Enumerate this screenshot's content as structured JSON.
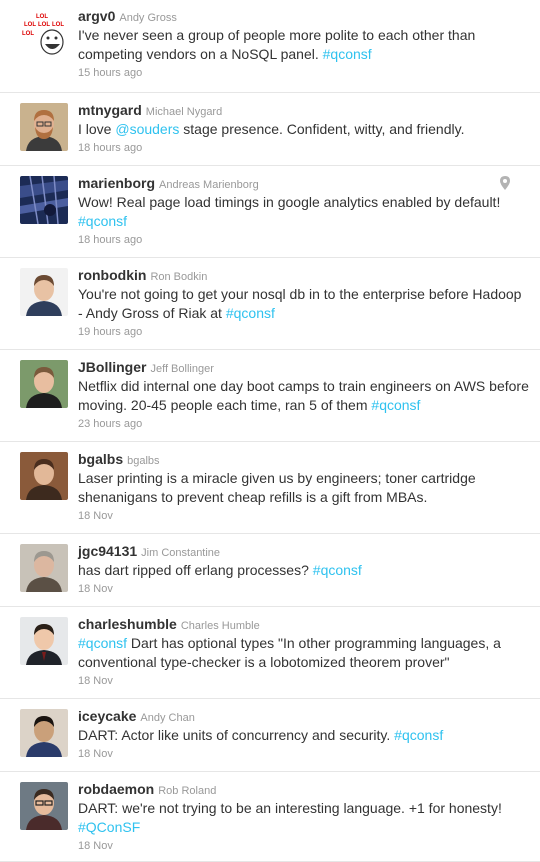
{
  "tweets": [
    {
      "screen_name": "argv0",
      "full_name": "Andy Gross",
      "avatar": "lol-face",
      "text": [
        {
          "t": "I've never seen a group of people more polite to each other than competing vendors on a NoSQL panel. "
        },
        {
          "t": "#qconsf",
          "link": true
        }
      ],
      "time": "15 hours ago"
    },
    {
      "screen_name": "mtnygard",
      "full_name": "Michael Nygard",
      "avatar": "bearded-man",
      "text": [
        {
          "t": "I love "
        },
        {
          "t": "@souders",
          "link": true
        },
        {
          "t": " stage presence. Confident, witty, and friendly."
        }
      ],
      "time": "18 hours ago"
    },
    {
      "screen_name": "marienborg",
      "full_name": "Andreas Marienborg",
      "avatar": "blue-abstract",
      "geo": "location-pin-icon",
      "text": [
        {
          "t": "Wow! Real page load timings in google analytics enabled by default! "
        },
        {
          "t": "#qconsf",
          "link": true
        }
      ],
      "time": "18 hours ago"
    },
    {
      "screen_name": "ronbodkin",
      "full_name": "Ron Bodkin",
      "avatar": "man-suit-gray",
      "text": [
        {
          "t": "You're not going to get your nosql db in to the enterprise before Hadoop - Andy Gross of Riak at "
        },
        {
          "t": "#qconsf",
          "link": true
        }
      ],
      "time": "19 hours ago"
    },
    {
      "screen_name": "JBollinger",
      "full_name": "Jeff Bollinger",
      "avatar": "man-outdoor",
      "text": [
        {
          "t": "Netflix did internal one day boot camps to train engineers on AWS before moving. 20-45 people each time, ran 5 of them "
        },
        {
          "t": "#qconsf",
          "link": true
        }
      ],
      "time": "23 hours ago"
    },
    {
      "screen_name": "bgalbs",
      "full_name": "bgalbs",
      "avatar": "man-brown",
      "text": [
        {
          "t": "Laser printing is a miracle given us by engineers; toner cartridge shenanigans to prevent cheap refills is a gift from MBAs."
        }
      ],
      "time": "18 Nov"
    },
    {
      "screen_name": "jgc94131",
      "full_name": "Jim Constantine",
      "avatar": "man-gray-hair",
      "text": [
        {
          "t": "has dart ripped off erlang processes? "
        },
        {
          "t": "#qconsf",
          "link": true
        }
      ],
      "time": "18 Nov"
    },
    {
      "screen_name": "charleshumble",
      "full_name": "Charles Humble",
      "avatar": "man-suit-light",
      "text": [
        {
          "t": "#qconsf",
          "link": true
        },
        {
          "t": " Dart has optional types \"In other programming languages, a conventional type-checker is a lobotomized theorem prover\""
        }
      ],
      "time": "18 Nov"
    },
    {
      "screen_name": "iceycake",
      "full_name": "Andy Chan",
      "avatar": "man-smiling",
      "text": [
        {
          "t": "DART: Actor like units of concurrency and security. "
        },
        {
          "t": "#qconsf",
          "link": true
        }
      ],
      "time": "18 Nov"
    },
    {
      "screen_name": "robdaemon",
      "full_name": "Rob Roland",
      "avatar": "man-glasses",
      "text": [
        {
          "t": "DART: we're not trying to be an interesting language. +1 for honesty! "
        },
        {
          "t": "#QConSF",
          "link": true
        }
      ],
      "time": "18 Nov"
    }
  ]
}
